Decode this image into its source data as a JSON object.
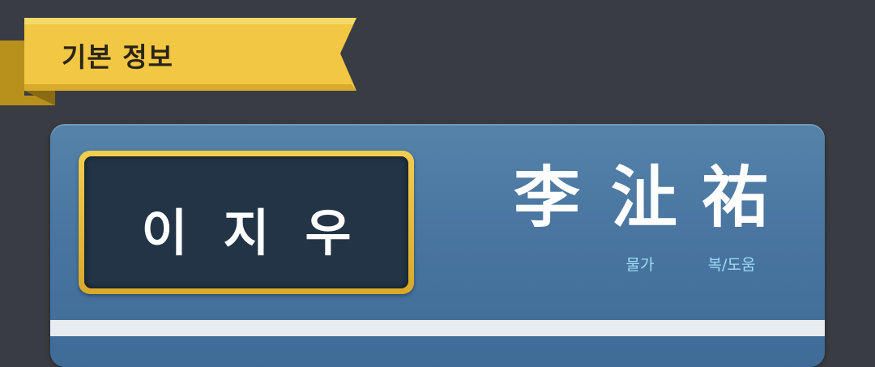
{
  "section": {
    "title": "기본 정보"
  },
  "profile": {
    "korean_name": "이지우",
    "hanja": [
      {
        "char": "李",
        "meaning": ""
      },
      {
        "char": "沚",
        "meaning": "물가"
      },
      {
        "char": "祐",
        "meaning": "복/도움"
      }
    ]
  },
  "colors": {
    "background": "#393c42",
    "ribbon": "#f2c743",
    "card": "#4975a0",
    "plate_border": "#e6bb3c",
    "plate_fill": "#223446",
    "meaning_text": "#9fdcf6"
  }
}
